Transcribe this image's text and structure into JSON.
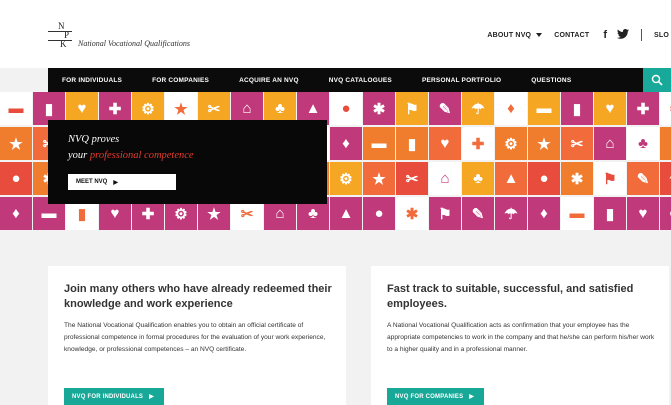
{
  "header": {
    "logo_letters": [
      "N",
      "P",
      "K"
    ],
    "logo_text": "National Vocational Qualifications",
    "nav": {
      "about": "ABOUT NVQ",
      "contact": "CONTACT",
      "facebook": "f",
      "twitter": "t",
      "language": "SLO"
    }
  },
  "main_nav": {
    "items": [
      "FOR INDIVIDUALS",
      "FOR COMPANIES",
      "ACQUIRE AN NVQ",
      "NVQ CATALOGUES",
      "PERSONAL PORTFOLIO",
      "QUESTIONS"
    ]
  },
  "hero": {
    "line1": "NVQ proves",
    "line2_prefix": "your",
    "line2_accent": "professional competence",
    "button": "MEET NVQ",
    "arrow": "▶"
  },
  "cards": [
    {
      "title": "Join many others who have already redeemed their knowledge and work experience",
      "body": "The National Vocational Qualification enables you to obtain an official certificate of professional competence in formal procedures for the evaluation of your work experience, knowledge, or professional competences – an NVQ certificate.",
      "button": "NVQ FOR INDIVIDUALS",
      "arrow": "▶"
    },
    {
      "title": "Fast track to suitable, successful, and satisfied employees.",
      "body": "A National Vocational Qualification acts as confirmation that your employee has the appropriate competencies to work in the company and that he/she can perform his/her work to a higher quality and in a professional manner.",
      "button": "NVQ FOR COMPANIES",
      "arrow": "▶"
    }
  ],
  "colors": {
    "accent": "#19a99a",
    "hero_accent": "#e63a2e",
    "tile_palette": [
      "#f5a623",
      "#ef7d2d",
      "#e84c3d",
      "#c0397a",
      "#e5407e",
      "#f26b3a"
    ]
  },
  "banner": {
    "icon_glyphs": [
      "▬",
      "▮",
      "♥",
      "✚",
      "⚙",
      "★",
      "✂",
      "⌂",
      "♣",
      "▲",
      "●",
      "✱",
      "⚑",
      "✎",
      "☂",
      "♦"
    ]
  }
}
